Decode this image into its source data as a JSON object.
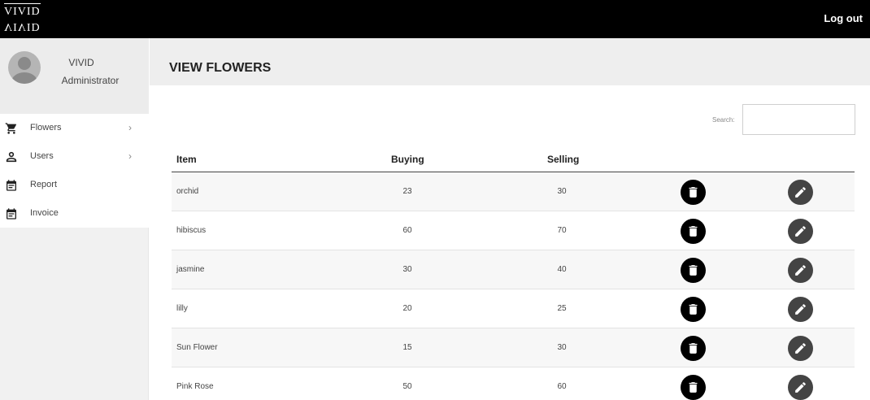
{
  "topbar": {
    "logo_line1": "VIVID",
    "logo_line2": "VIVID",
    "logout_label": "Log out"
  },
  "profile": {
    "name": "VIVID",
    "role": "Administrator"
  },
  "menu": {
    "items": [
      {
        "label": "Flowers",
        "icon": "cart-icon",
        "has_submenu": true
      },
      {
        "label": "Users",
        "icon": "user-icon",
        "has_submenu": true
      },
      {
        "label": "Report",
        "icon": "calendar-icon",
        "has_submenu": false
      },
      {
        "label": "Invoice",
        "icon": "calendar-icon",
        "has_submenu": false
      }
    ]
  },
  "page": {
    "title": "VIEW FLOWERS"
  },
  "search": {
    "label": "Search:",
    "value": ""
  },
  "table": {
    "headers": [
      "Item",
      "Buying",
      "Selling"
    ],
    "rows": [
      {
        "item": "orchid",
        "buying": "23",
        "selling": "30"
      },
      {
        "item": "hibiscus",
        "buying": "60",
        "selling": "70"
      },
      {
        "item": "jasmine",
        "buying": "30",
        "selling": "40"
      },
      {
        "item": "lilly",
        "buying": "20",
        "selling": "25"
      },
      {
        "item": "Sun Flower",
        "buying": "15",
        "selling": "30"
      },
      {
        "item": "Pink Rose",
        "buying": "50",
        "selling": "60"
      }
    ],
    "row_actions": [
      "delete-icon",
      "edit-icon"
    ]
  },
  "colors": {
    "topbar": "#000000",
    "delete_button": "#000000",
    "edit_button": "#444444"
  }
}
